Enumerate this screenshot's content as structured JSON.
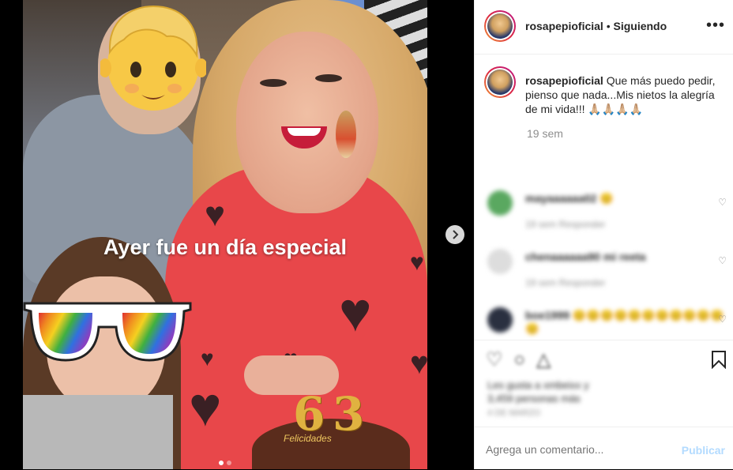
{
  "post": {
    "username": "rosapepioficial",
    "follow_separator": "•",
    "follow_status": "Siguiendo",
    "more_icon": "more-horizontal-icon",
    "caption_user": "rosapepioficial",
    "caption_text": "Que más puedo pedir, pienso que nada...Mis nietos la alegría de mi vida!!! 🙏🏼🙏🏼🙏🏼🙏🏼",
    "time_ago": "19 sem"
  },
  "media": {
    "sticker_text": "Ayer fue un día especial",
    "cake_text": "Felicidades",
    "candle_digits": [
      "6",
      "3"
    ]
  },
  "comments": [
    {
      "user": "mayaaaaaa02 😊",
      "meta": "19 sem   Responder"
    },
    {
      "user": "chenaaaaaa90 mi reeta",
      "meta": "19 sem   Responder"
    },
    {
      "user": "boe1999 😊😊😊😊😊😊😊😊😊😊😊😊",
      "meta": ""
    }
  ],
  "actions": {
    "likes_text": "Les gusta a xmbeixx y",
    "likes_count": "3,459 personas más",
    "date": "4 DE MARZO"
  },
  "comment_box": {
    "placeholder": "Agrega un comentario...",
    "publish_label": "Publicar"
  },
  "colors": {
    "accent": "#b3dbff",
    "text": "#262626",
    "muted": "#8e8e8e",
    "sweater": "#e8474a"
  }
}
